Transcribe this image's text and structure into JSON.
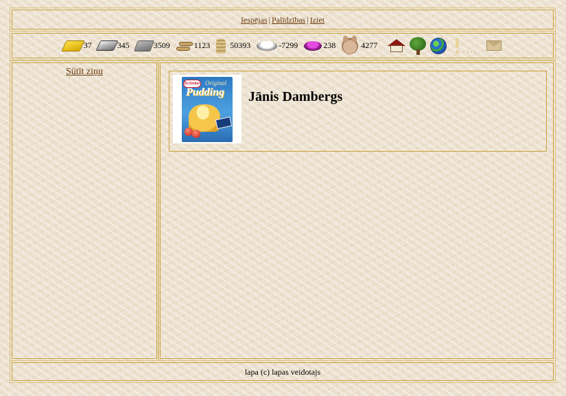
{
  "topnav": {
    "links": [
      "Iespējas",
      "Palīdzības",
      "Iziet"
    ],
    "separator": "|"
  },
  "resources": [
    {
      "icon": "gold-bar-icon",
      "value": "37"
    },
    {
      "icon": "iron-ingot-icon",
      "value": "345"
    },
    {
      "icon": "stone-block-icon",
      "value": "3509"
    },
    {
      "icon": "wood-logs-icon",
      "value": "1123"
    },
    {
      "icon": "grain-sack-icon",
      "value": "50393"
    },
    {
      "icon": "milk-bowl-icon",
      "value": "-7299"
    },
    {
      "icon": "dye-bowl-icon",
      "value": "238"
    },
    {
      "icon": "pig-icon",
      "value": "4277"
    }
  ],
  "toolbar_icons": [
    "house-icon",
    "tree-icon",
    "globe-icon",
    "exclamation-icon",
    "ellipsis-icon",
    "mail-icon"
  ],
  "sidebar": {
    "send_message": "Sūtīt ziņu"
  },
  "profile": {
    "name": "Jānis Dambergs",
    "avatar": {
      "brand": "Dr.Oetker",
      "original": "Original",
      "product": "Pudding"
    }
  },
  "footer": {
    "text": "lapa (c) lapas veidotajs"
  },
  "colors": {
    "border": "#c9a23a",
    "link": "#6b3a0c",
    "background": "#ece1cf"
  }
}
